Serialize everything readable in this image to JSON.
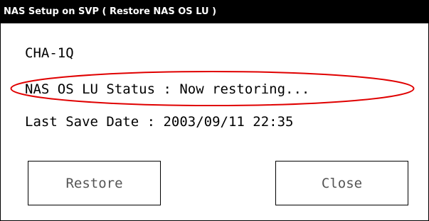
{
  "window": {
    "title": "NAS Setup on SVP ( Restore NAS OS LU )"
  },
  "content": {
    "device_label": "CHA-1Q",
    "status_line": "NAS OS LU Status : Now restoring...",
    "last_save_line": "Last Save Date : 2003/09/11 22:35"
  },
  "buttons": {
    "restore_label": "Restore",
    "close_label": "Close"
  },
  "colors": {
    "title_bar": "#000000",
    "title_text": "#ffffff",
    "highlight_ellipse": "#e00000"
  }
}
